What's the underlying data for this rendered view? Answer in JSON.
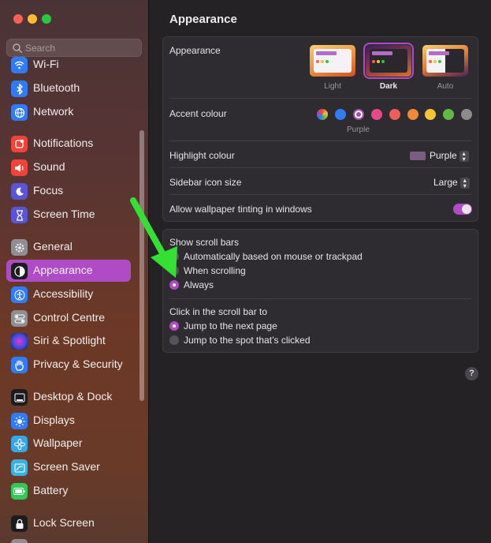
{
  "window": {
    "title": "Appearance"
  },
  "sidebar": {
    "search_placeholder": "Search",
    "items": [
      {
        "label": "Wi-Fi",
        "icon": "wifi-icon",
        "color": "#2f7cf6"
      },
      {
        "label": "Bluetooth",
        "icon": "bluetooth-icon",
        "color": "#2f7cf6"
      },
      {
        "label": "Network",
        "icon": "globe-icon",
        "color": "#2f7cf6"
      },
      {
        "label": "Notifications",
        "icon": "bell-icon",
        "color": "#f0443a"
      },
      {
        "label": "Sound",
        "icon": "speaker-icon",
        "color": "#f0443a"
      },
      {
        "label": "Focus",
        "icon": "moon-icon",
        "color": "#5a55d6"
      },
      {
        "label": "Screen Time",
        "icon": "hourglass-icon",
        "color": "#5a55d6"
      },
      {
        "label": "General",
        "icon": "gear-icon",
        "color": "#8e8e93"
      },
      {
        "label": "Appearance",
        "icon": "appearance-icon",
        "color": "#1c1c1e",
        "active": true
      },
      {
        "label": "Accessibility",
        "icon": "accessibility-icon",
        "color": "#2f7cf6"
      },
      {
        "label": "Control Centre",
        "icon": "switches-icon",
        "color": "#8e8e93"
      },
      {
        "label": "Siri & Spotlight",
        "icon": "siri-icon",
        "color": "#6a3ad8"
      },
      {
        "label": "Privacy & Security",
        "icon": "hand-icon",
        "color": "#2f7cf6"
      },
      {
        "label": "Desktop & Dock",
        "icon": "dock-icon",
        "color": "#1c1c1e"
      },
      {
        "label": "Displays",
        "icon": "sun-icon",
        "color": "#2f7cf6"
      },
      {
        "label": "Wallpaper",
        "icon": "flower-icon",
        "color": "#35a7e8"
      },
      {
        "label": "Screen Saver",
        "icon": "screensaver-icon",
        "color": "#3ab2e0"
      },
      {
        "label": "Battery",
        "icon": "battery-icon",
        "color": "#34c759"
      },
      {
        "label": "Lock Screen",
        "icon": "lock-icon",
        "color": "#1c1c1e"
      }
    ]
  },
  "appearance": {
    "label": "Appearance",
    "options": [
      "Light",
      "Dark",
      "Auto"
    ],
    "selected": "Dark"
  },
  "accent": {
    "label": "Accent colour",
    "colors": [
      "multicolor",
      "#2f7cf6",
      "#a550a7",
      "#e6488a",
      "#ec5e5c",
      "#f0883a",
      "#f5c534",
      "#62ba46",
      "#8c8c8c"
    ],
    "selected_name": "Purple"
  },
  "highlight": {
    "label": "Highlight colour",
    "value": "Purple"
  },
  "sidebar_icon_size": {
    "label": "Sidebar icon size",
    "value": "Large"
  },
  "wallpaper_tinting": {
    "label": "Allow wallpaper tinting in windows",
    "enabled": true
  },
  "scroll_bars": {
    "label": "Show scroll bars",
    "options": [
      "Automatically based on mouse or trackpad",
      "When scrolling",
      "Always"
    ],
    "selected": "Always"
  },
  "click_scroll": {
    "label": "Click in the scroll bar to",
    "options": [
      "Jump to the next page",
      "Jump to the spot that’s clicked"
    ],
    "selected": "Jump to the next page"
  },
  "help_label": "?"
}
